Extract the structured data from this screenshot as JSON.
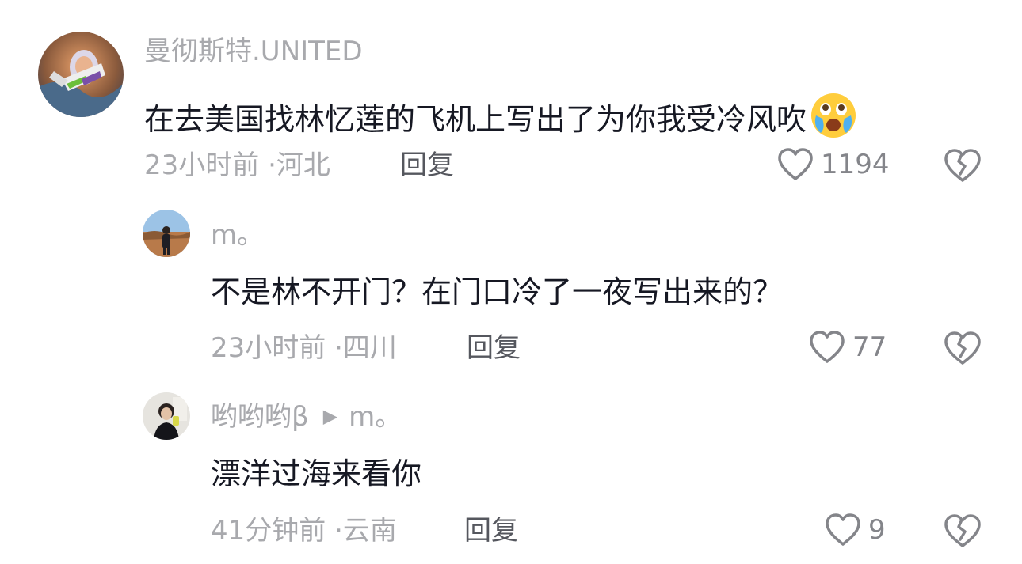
{
  "comments": [
    {
      "username": "曼彻斯特.UNITED",
      "text": "在去美国找林忆莲的飞机上写出了为你我受冷风吹",
      "emoji": "crying-face-emoji",
      "time": "23小时前",
      "location": "河北",
      "reply_label": "回复",
      "likes": "1194"
    },
    {
      "username": "m。",
      "text": "不是林不开门？在门口冷了一夜写出来的？",
      "time": "23小时前",
      "location": "四川",
      "reply_label": "回复",
      "likes": "77"
    },
    {
      "username": "哟哟哟β",
      "reply_to": "m。",
      "text": "漂洋过海来看你",
      "time": "41分钟前",
      "location": "云南",
      "reply_label": "回复",
      "likes": "9"
    }
  ],
  "separator": "·",
  "colors": {
    "text": "#161823",
    "meta": "#a8a9ad",
    "reply": "#55575e",
    "icon": "#84858a"
  }
}
